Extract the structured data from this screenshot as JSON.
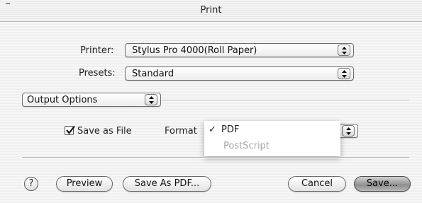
{
  "window": {
    "title": "Print"
  },
  "printer": {
    "label": "Printer:",
    "value": "Stylus Pro 4000(Roll Paper)"
  },
  "presets": {
    "label": "Presets:",
    "value": "Standard"
  },
  "panel": {
    "value": "Output Options"
  },
  "save_as_file": {
    "label": "Save as File",
    "checked": true
  },
  "format": {
    "label": "Format",
    "options": [
      {
        "label": "PDF",
        "selected": true,
        "enabled": true
      },
      {
        "label": "PostScript",
        "selected": false,
        "enabled": false
      }
    ]
  },
  "buttons": {
    "help": "?",
    "preview": "Preview",
    "save_as_pdf": "Save As PDF...",
    "cancel": "Cancel",
    "save": "Save..."
  },
  "icons": {
    "check": "checkmark-icon",
    "stepper": "up-down-arrows-icon"
  }
}
